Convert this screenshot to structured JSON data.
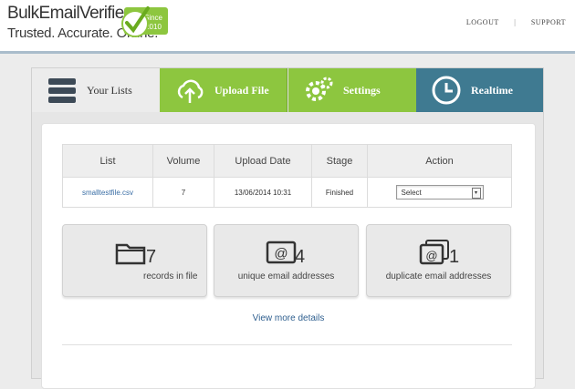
{
  "brand": {
    "title": "BulkEmailVerifier.com",
    "tagline": "Trusted. Accurate. Online.",
    "badge_text": "Since 2010"
  },
  "top_nav": {
    "logout": "LOGOUT",
    "separator": "|",
    "support": "SUPPORT"
  },
  "tabs": [
    {
      "label": "Your Lists",
      "icon": "list-icon"
    },
    {
      "label": "Upload File",
      "icon": "cloud-upload-icon"
    },
    {
      "label": "Settings",
      "icon": "gear-icon"
    },
    {
      "label": "Realtime",
      "icon": "clock-icon"
    }
  ],
  "table": {
    "headers": [
      "List",
      "Volume",
      "Upload Date",
      "Stage",
      "Action"
    ],
    "rows": [
      {
        "list": "smalltestfile.csv",
        "volume": "7",
        "upload_date": "13/06/2014 10:31",
        "stage": "Finished",
        "action": "Select"
      }
    ]
  },
  "stats": [
    {
      "count": "7",
      "label": "records in file",
      "icon": "folder-icon"
    },
    {
      "count": "4",
      "label": "unique email addresses",
      "icon": "at-sign-icon"
    },
    {
      "count": "1",
      "label": "duplicate email addresses",
      "icon": "duplicate-at-icon"
    }
  ],
  "more_link": "View more details",
  "colors": {
    "green_tab": "#8dc63f",
    "blue_tab": "#3f7a91",
    "link": "#2f5f8f"
  }
}
